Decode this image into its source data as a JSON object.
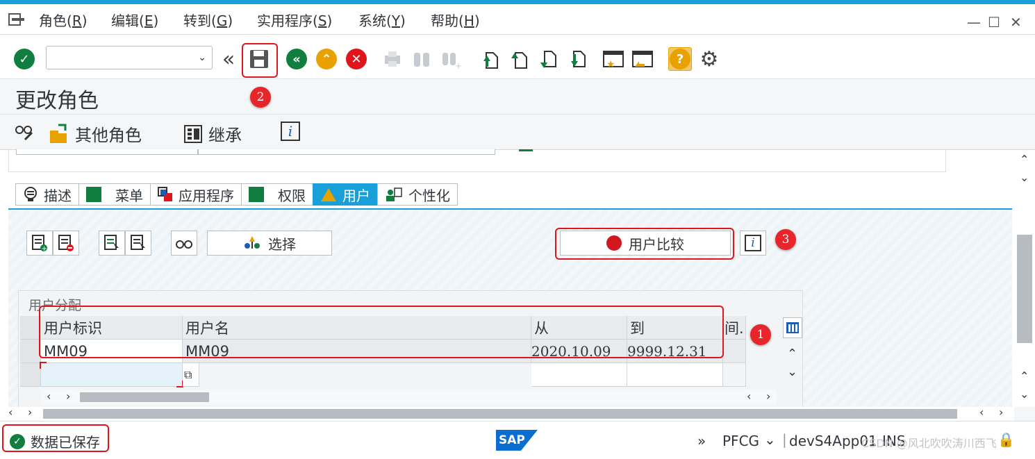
{
  "menu": {
    "items": [
      {
        "label": "角色(",
        "key": "R",
        "end": ")"
      },
      {
        "label": "编辑(",
        "key": "E",
        "end": ")"
      },
      {
        "label": "转到(",
        "key": "G",
        "end": ")"
      },
      {
        "label": "实用程序(",
        "key": "S",
        "end": ")"
      },
      {
        "label": "系统(",
        "key": "Y",
        "end": ")"
      },
      {
        "label": "帮助(",
        "key": "H",
        "end": ")"
      }
    ]
  },
  "window": {
    "minimize": "—",
    "maximize": "☐",
    "close": "✕"
  },
  "toolbar": {
    "command_value": "",
    "collapse": "«"
  },
  "page_title": "更改角色",
  "app_toolbar": {
    "other_roles": "其他角色",
    "inherit": "继承",
    "info": "i"
  },
  "tabs": [
    {
      "label": "描述"
    },
    {
      "label": "菜单"
    },
    {
      "label": "应用程序"
    },
    {
      "label": "权限"
    },
    {
      "label": "用户"
    },
    {
      "label": "个性化"
    }
  ],
  "users_tab": {
    "select_button": "选择",
    "compare_button": "用户比较",
    "info": "i",
    "section_title": "用户分配",
    "columns": [
      "用户标识",
      "用户名",
      "从",
      "到",
      "间."
    ],
    "rows": [
      {
        "user_id": "MM09",
        "user_name": "MM09",
        "from": "2020.10.09",
        "to": "9999.12.31"
      }
    ]
  },
  "annotations": {
    "badge1": "1",
    "badge2": "2",
    "badge3": "3"
  },
  "status": {
    "message": "数据已保存",
    "sap_logo": "SAP",
    "transaction": "PFCG",
    "system": "devS4App01",
    "mode": "INS",
    "watermark": "CSDN @风北吹吹涛川西飞"
  },
  "colors": {
    "accent": "#1aa0d8",
    "success": "#107e3e",
    "error": "#e0151b",
    "warning": "#e9a100"
  }
}
